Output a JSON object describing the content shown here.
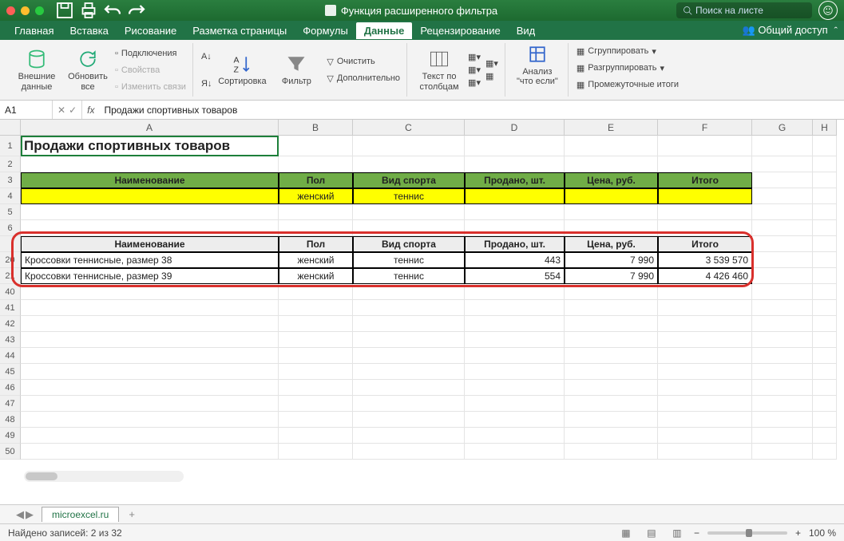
{
  "window": {
    "title": "Функция расширенного фильтра"
  },
  "search": {
    "placeholder": "Поиск на листе"
  },
  "tabs": {
    "items": [
      "Главная",
      "Вставка",
      "Рисование",
      "Разметка страницы",
      "Формулы",
      "Данные",
      "Рецензирование",
      "Вид"
    ],
    "active": "Данные",
    "share": "Общий доступ"
  },
  "ribbon": {
    "external": "Внешние данные",
    "refresh": "Обновить все",
    "connections": "Подключения",
    "properties": "Свойства",
    "editlinks": "Изменить связи",
    "sort": "Сортировка",
    "filter": "Фильтр",
    "clear": "Очистить",
    "advanced": "Дополнительно",
    "textcol": "Текст по столбцам",
    "whatif": "Анализ \"что если\"",
    "group": "Сгруппировать",
    "ungroup": "Разгруппировать",
    "subtotal": "Промежуточные итоги"
  },
  "fbar": {
    "name": "A1",
    "fx": "fx",
    "content": "Продажи спортивных товаров"
  },
  "cols": [
    "A",
    "B",
    "C",
    "D",
    "E",
    "F",
    "G",
    "H"
  ],
  "rows_visible": [
    "1",
    "2",
    "3",
    "4",
    "5",
    "6",
    "",
    "20",
    "21",
    "40",
    "41",
    "42",
    "43",
    "44",
    "45",
    "46",
    "47",
    "48",
    "49",
    "50"
  ],
  "sheet": {
    "title": "Продажи спортивных товаров",
    "headers": [
      "Наименование",
      "Пол",
      "Вид спорта",
      "Продано, шт.",
      "Цена, руб.",
      "Итого"
    ],
    "criteria": [
      "",
      "женский",
      "теннис",
      "",
      "",
      ""
    ],
    "result_headers": [
      "Наименование",
      "Пол",
      "Вид спорта",
      "Продано, шт.",
      "Цена, руб.",
      "Итого"
    ],
    "results": [
      [
        "Кроссовки теннисные, размер 38",
        "женский",
        "теннис",
        "443",
        "7 990",
        "3 539 570"
      ],
      [
        "Кроссовки теннисные, размер 39",
        "женский",
        "теннис",
        "554",
        "7 990",
        "4 426 460"
      ]
    ]
  },
  "sheettab": {
    "name": "microexcel.ru"
  },
  "status": {
    "text": "Найдено записей: 2 из 32",
    "zoom": "100 %"
  }
}
